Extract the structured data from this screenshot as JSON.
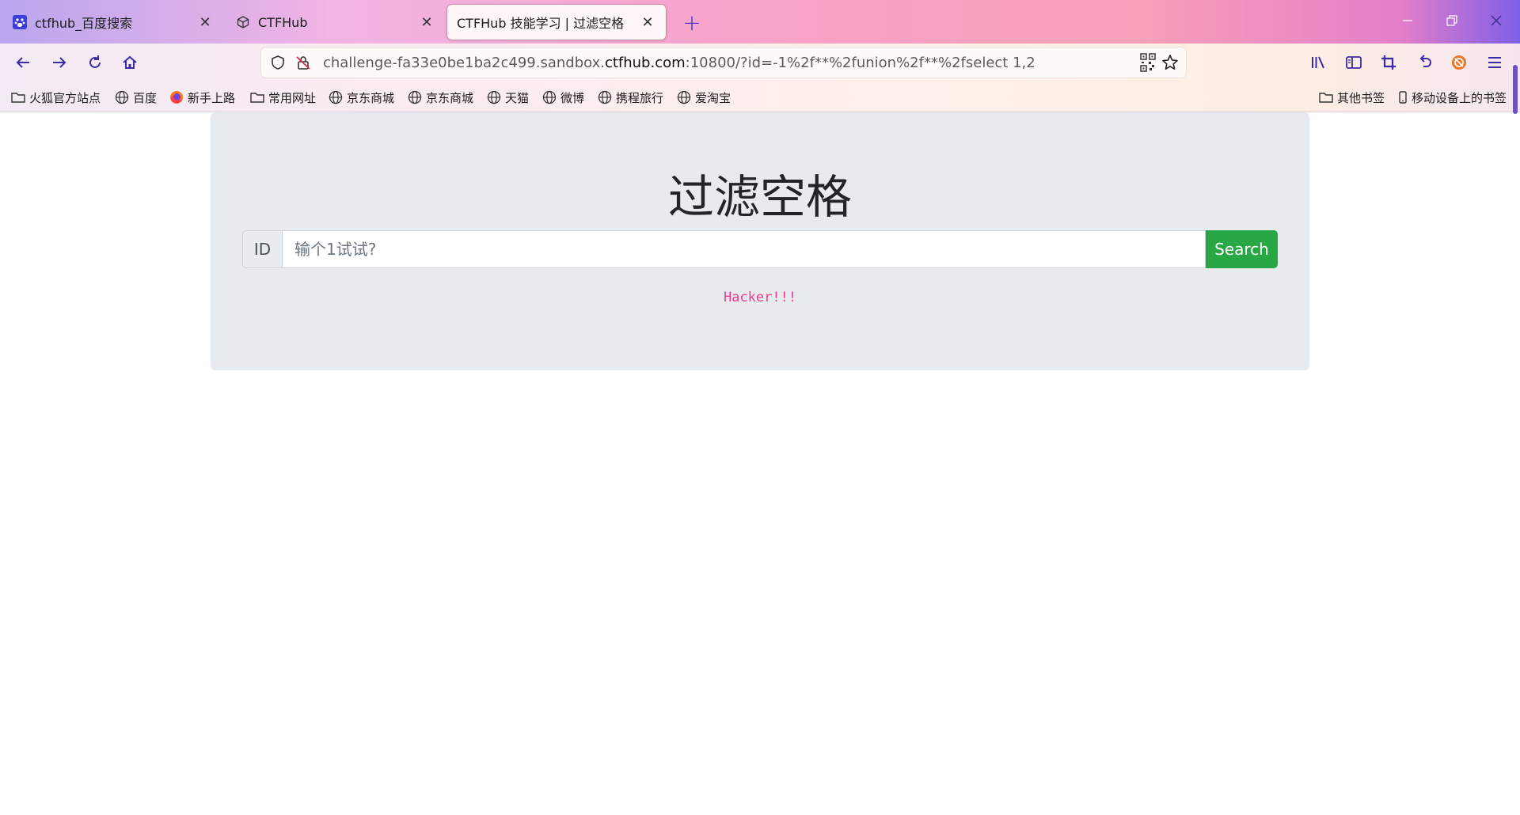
{
  "browser": {
    "tabs": [
      {
        "label": "ctfhub_百度搜索",
        "favicon": "baidu-paw-icon",
        "active": false
      },
      {
        "label": "CTFHub",
        "favicon": "ctfhub-cube-icon",
        "active": false
      },
      {
        "label": "CTFHub 技能学习 | 过滤空格",
        "favicon": "",
        "active": true
      }
    ],
    "url": {
      "prefix": "challenge-fa33e0be1ba2c499.sandbox.",
      "domain": "ctfhub.com",
      "suffix": ":10800/?id=-1%2f**%2funion%2f**%2fselect 1,2"
    },
    "bookmarks_left": [
      {
        "label": "火狐官方站点",
        "icon": "folder-icon"
      },
      {
        "label": "百度",
        "icon": "globe-icon"
      },
      {
        "label": "新手上路",
        "icon": "firefox-icon"
      },
      {
        "label": "常用网址",
        "icon": "folder-icon"
      },
      {
        "label": "京东商城",
        "icon": "globe-icon"
      },
      {
        "label": "京东商城",
        "icon": "globe-icon"
      },
      {
        "label": "天猫",
        "icon": "globe-icon"
      },
      {
        "label": "微博",
        "icon": "globe-icon"
      },
      {
        "label": "携程旅行",
        "icon": "globe-icon"
      },
      {
        "label": "爱淘宝",
        "icon": "globe-icon"
      }
    ],
    "bookmarks_right": [
      {
        "label": "其他书签",
        "icon": "folder-icon"
      },
      {
        "label": "移动设备上的书签",
        "icon": "mobile-icon"
      }
    ],
    "accent_color": "#3b2ba8"
  },
  "page": {
    "title": "过滤空格",
    "id_prefix": "ID",
    "input_placeholder": "输个1试试?",
    "input_value": "",
    "search_label": "Search",
    "result_text": "Hacker!!!",
    "search_color": "#28a745",
    "result_color": "#e83e8c"
  }
}
